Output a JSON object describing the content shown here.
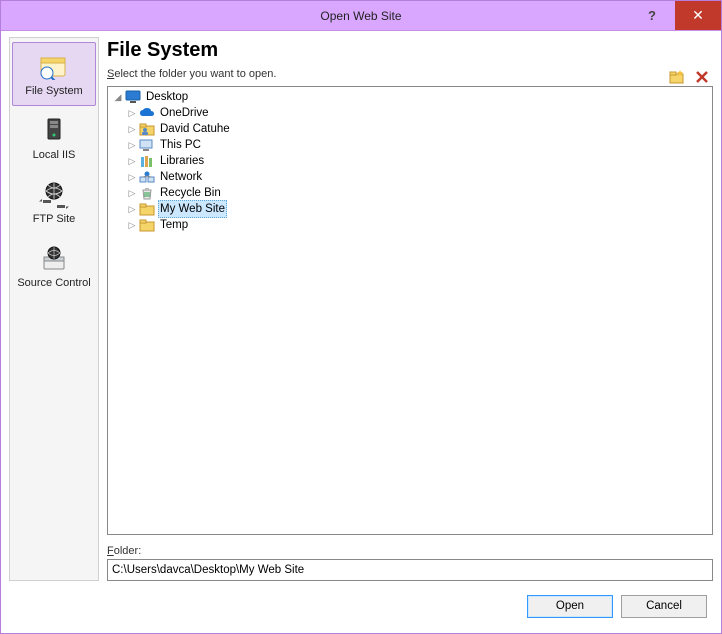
{
  "window": {
    "title": "Open Web Site",
    "help": "?",
    "close": "✕"
  },
  "sidebar": {
    "items": [
      {
        "label": "File System",
        "icon": "file-system-icon"
      },
      {
        "label": "Local IIS",
        "icon": "local-iis-icon"
      },
      {
        "label": "FTP Site",
        "icon": "ftp-site-icon"
      },
      {
        "label": "Source Control",
        "icon": "source-control-icon"
      }
    ],
    "selected_index": 0
  },
  "main": {
    "title": "File System",
    "subtitle_prefix": "S",
    "subtitle_rest": "elect the folder you want to open.",
    "toolbar": {
      "new_folder": "new-folder-icon",
      "delete": "delete-icon"
    }
  },
  "tree": {
    "root": {
      "label": "Desktop",
      "icon": "desktop-icon"
    },
    "children": [
      {
        "label": "OneDrive",
        "icon": "onedrive-icon",
        "selected": false
      },
      {
        "label": "David Catuhe",
        "icon": "user-folder-icon",
        "selected": false
      },
      {
        "label": "This PC",
        "icon": "pc-icon",
        "selected": false
      },
      {
        "label": "Libraries",
        "icon": "libraries-icon",
        "selected": false
      },
      {
        "label": "Network",
        "icon": "network-icon",
        "selected": false
      },
      {
        "label": "Recycle Bin",
        "icon": "recycle-icon",
        "selected": false
      },
      {
        "label": "My Web Site",
        "icon": "folder-icon",
        "selected": true
      },
      {
        "label": "Temp",
        "icon": "folder-icon",
        "selected": false
      }
    ]
  },
  "folder": {
    "label_prefix": "F",
    "label_rest": "older:",
    "value": "C:\\Users\\davca\\Desktop\\My Web Site"
  },
  "buttons": {
    "open": "Open",
    "cancel": "Cancel"
  }
}
